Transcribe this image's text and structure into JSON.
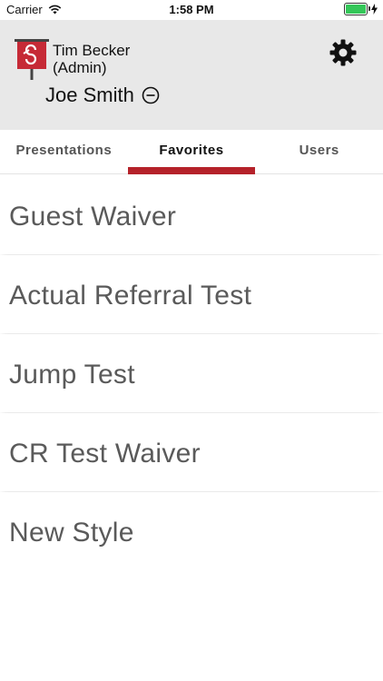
{
  "status_bar": {
    "carrier": "Carrier",
    "time": "1:58 PM",
    "battery_level": 1.0
  },
  "header": {
    "admin_name": "Tim Becker",
    "admin_role": "(Admin)",
    "user_name": "Joe Smith",
    "logo_color": "#c62a36",
    "settings_icon": "gear-icon",
    "remove_icon": "minus-circle-icon"
  },
  "tabs": [
    {
      "label": "Presentations",
      "active": false
    },
    {
      "label": "Favorites",
      "active": true
    },
    {
      "label": "Users",
      "active": false
    }
  ],
  "accent_color": "#b5222a",
  "favorites": [
    {
      "title": "Guest Waiver"
    },
    {
      "title": "Actual Referral Test"
    },
    {
      "title": "Jump Test"
    },
    {
      "title": "CR Test Waiver"
    },
    {
      "title": "New Style"
    }
  ]
}
